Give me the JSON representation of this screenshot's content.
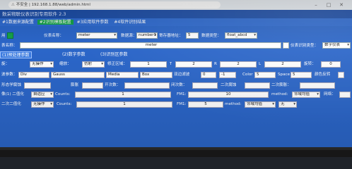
{
  "browser": {
    "security": "不安全",
    "url": "192.168.1.88/web/admin.html",
    "win_min": "–",
    "win_max": "□",
    "win_close": "✕"
  },
  "app": {
    "title": "数采物联仪表识别专用软件 2.3",
    "menu": [
      "#1数据来源配置",
      "#2识别模板配置",
      "#3应用软件参数",
      "#4软件识别结果"
    ],
    "active_menu": 1,
    "row1": {
      "enabled_label": "用",
      "instrument_name_label": "仪表名称：",
      "instrument_name_value": "meter",
      "address_label": "数据源：",
      "address_value": "number1",
      "register_label": "寄存器地址：",
      "register_value": "5",
      "datatype_label": "数据类型：",
      "datatype_value": "float_abcd"
    },
    "row2": {
      "meter_label": "表名称：",
      "meter_value": "meter",
      "ocr_type_label": "仪表识别类型：",
      "ocr_type_value": "数字仪表"
    },
    "tabs": [
      "(1)预处理参数",
      "(2)数字参数",
      "(3)识别区参数"
    ],
    "active_tab": 0,
    "grid": {
      "r1": {
        "a_label": "旋：",
        "a_value": "无操作",
        "b_label": "缩放：",
        "b_value": "仿射",
        "c_label": "修正区域：",
        "c_v1": "1",
        "c_v2": "2",
        "t_label": "T",
        "r_label": "R",
        "l_label": "L",
        "rot_label": "旋转：",
        "rot_value": "0"
      },
      "r2": {
        "label": "波参数：",
        "items": [
          "Div",
          "Gauss",
          "Media",
          "Box"
        ],
        "thr_label": "双边滤波",
        "thr_v1": "0",
        "thr_v2": "-1",
        "color_label": "Color",
        "color_v": "5",
        "space_label": "Space",
        "space_v": "5",
        "invert_label": "颜色反转"
      },
      "r3": {
        "label": "形态学腐蚀",
        "items": [
          "膨胀",
          "开次数：",
          "闭次数：",
          "二次腐蚀",
          "二次膨胀："
        ]
      },
      "r4": {
        "label": "像(1) 二值化",
        "mode_value": "自适应",
        "counts_label": "Counts:",
        "counts_value": "1",
        "fm_label": "FM1:",
        "fm_value": "10",
        "method_label": "method:",
        "method_value": "邻域均值",
        "edge_label": "网络："
      },
      "r5": {
        "label": "二次二值化",
        "mode_value": "无操作",
        "counts_label": "Counts:",
        "counts_value": "1",
        "fm_label": "FM1:",
        "fm_value": "5",
        "method_label": "method:",
        "method_value": "邻域均值",
        "extra_value": "无"
      }
    }
  }
}
